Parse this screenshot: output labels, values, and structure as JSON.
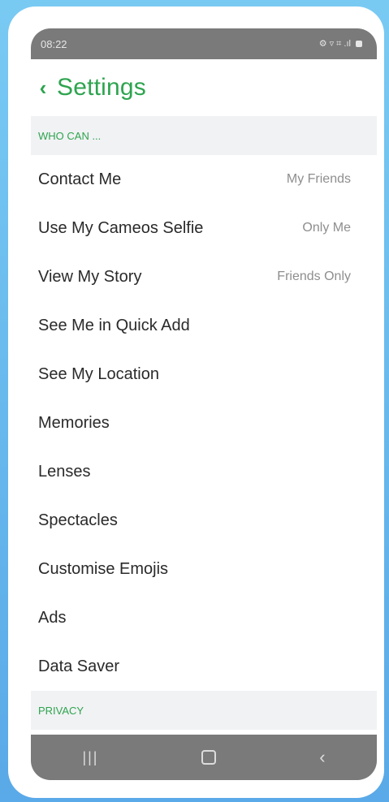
{
  "status_bar": {
    "time": "08:22",
    "icons": "⚙ ▿ ⌗ .ıl"
  },
  "header": {
    "back_glyph": "‹",
    "title": "Settings"
  },
  "sections": [
    {
      "title": "WHO CAN ...",
      "items": [
        {
          "label": "Contact Me",
          "value": "My Friends"
        },
        {
          "label": "Use My Cameos Selfie",
          "value": "Only Me"
        },
        {
          "label": "View My Story",
          "value": "Friends Only"
        },
        {
          "label": "See Me in Quick Add",
          "value": ""
        },
        {
          "label": "See My Location",
          "value": ""
        },
        {
          "label": "Memories",
          "value": ""
        },
        {
          "label": "Lenses",
          "value": ""
        },
        {
          "label": "Spectacles",
          "value": ""
        },
        {
          "label": "Customise Emojis",
          "value": ""
        },
        {
          "label": "Ads",
          "value": ""
        },
        {
          "label": "Data Saver",
          "value": ""
        }
      ]
    },
    {
      "title": "PRIVACY",
      "items": []
    }
  ],
  "nav_bar": {
    "recent_glyph": "|||",
    "back_glyph": "‹"
  },
  "colors": {
    "accent": "#2ea44f",
    "bar": "#7a7a7a",
    "section_bg": "#f1f2f4",
    "background": "#6ab9ee"
  }
}
